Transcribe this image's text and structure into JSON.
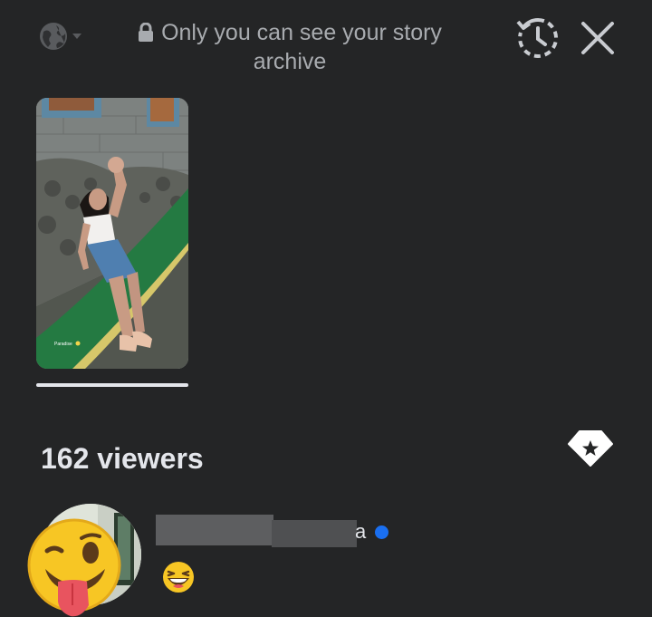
{
  "header": {
    "privacy_icon": "globe-icon",
    "notice_text": "Only you can see your story archive",
    "archive_icon": "history-icon",
    "close_icon": "close-icon"
  },
  "story": {
    "thumbnail_caption": "Paradise"
  },
  "viewers": {
    "count_label": "162 viewers",
    "star_icon": "star-tag-icon",
    "list": [
      {
        "name_visible_suffix": "a",
        "online": true,
        "reaction": "grinning-squinting-face"
      }
    ]
  },
  "colors": {
    "background": "#242526",
    "text_primary": "#e4e6eb",
    "text_secondary": "#a8abaf",
    "online_dot": "#1a6ff0"
  }
}
